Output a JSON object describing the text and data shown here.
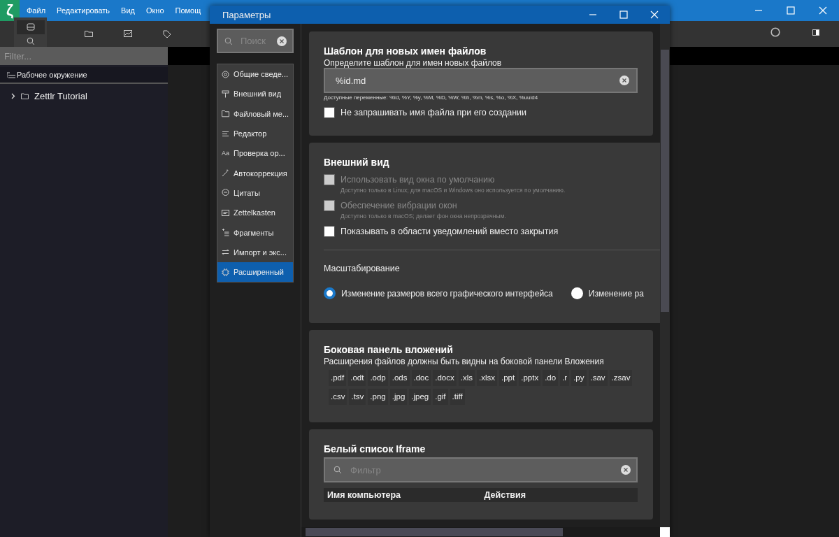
{
  "app": {
    "logo": "ζ",
    "menu": [
      "Файл",
      "Редактировать",
      "Вид",
      "Окно",
      "Помощ"
    ],
    "filter": {
      "placeholder": "Filter..."
    },
    "workspace_header": "Рабочее окружение",
    "tree": [
      {
        "label": "Zettlr Tutorial",
        "expanded": false
      }
    ]
  },
  "dialog": {
    "title": "Параметры",
    "search": {
      "placeholder": "Поиск"
    },
    "nav": [
      {
        "label": "Общие сведе...",
        "kind": "gear",
        "selected": false
      },
      {
        "label": "Внешний вид",
        "kind": "roller",
        "selected": false
      },
      {
        "label": "Файловый ме...",
        "kind": "folder",
        "selected": false
      },
      {
        "label": "Редактор",
        "kind": "lines",
        "selected": false
      },
      {
        "label": "Проверка ор...",
        "kind": "glyph",
        "glyph": "Aa",
        "selected": false
      },
      {
        "label": "Автокоррекция",
        "kind": "wand",
        "selected": false
      },
      {
        "label": "Цитаты",
        "kind": "bubble",
        "selected": false
      },
      {
        "label": "Zettelkasten",
        "kind": "card",
        "selected": false
      },
      {
        "label": "Фрагменты",
        "kind": "indent",
        "selected": false
      },
      {
        "label": "Импорт и экс...",
        "kind": "arrows",
        "selected": false
      },
      {
        "label": "Расширенный",
        "kind": "chip",
        "selected": true
      }
    ],
    "sections": [
      {
        "title": "Шаблон для новых имен файлов",
        "description": "Определите шаблон для имен новых файлов",
        "controls": [
          {
            "kind": "field",
            "value": "%id.md",
            "hint": "Доступные переменные: %id, %Y, %y, %M, %D, %W, %h, %m, %s, %o, %X, %uuid4"
          },
          {
            "kind": "checkbox",
            "label": "Не запрашивать имя файла при его создании",
            "checked": false,
            "disabled": false
          }
        ]
      },
      {
        "title": "Внешний вид",
        "controls": [
          {
            "kind": "checkbox",
            "label": "Использовать вид окна по умолчанию",
            "note": "Доступно только в Linux; для macOS и Windows оно используется по умолчанию.",
            "checked": false,
            "disabled": true
          },
          {
            "kind": "checkbox",
            "label": "Обеспечение вибрации окон",
            "note": "Доступно только в macOS; делает фон окна непрозрачным.",
            "checked": false,
            "disabled": true
          },
          {
            "kind": "checkbox",
            "label": "Показывать в области уведомлений вместо закрытия",
            "checked": false,
            "disabled": false
          },
          {
            "kind": "subheading",
            "label": "Масштабирование"
          },
          {
            "kind": "radios",
            "options": [
              {
                "label": "Изменение размеров всего графического интерфейса",
                "selected": true
              },
              {
                "label": "Изменение ра",
                "selected": false
              }
            ]
          }
        ]
      },
      {
        "title": "Боковая панель вложений",
        "description": "Расширения файлов должны быть видны на боковой панели Вложения",
        "controls": [
          {
            "kind": "tags",
            "items": [
              ".pdf",
              ".odt",
              ".odp",
              ".ods",
              ".doc",
              ".docx",
              ".xls",
              ".xlsx",
              ".ppt",
              ".pptx",
              ".do",
              ".r",
              ".py",
              ".sav",
              ".zsav",
              ".csv",
              ".tsv",
              ".png",
              ".jpg",
              ".jpeg",
              ".gif",
              ".tiff"
            ]
          }
        ]
      },
      {
        "title": "Белый список Iframe",
        "controls": [
          {
            "kind": "filter",
            "placeholder": "Фильтр"
          },
          {
            "kind": "table",
            "columns": [
              "Имя компьютера",
              "Действия"
            ]
          }
        ]
      }
    ]
  }
}
